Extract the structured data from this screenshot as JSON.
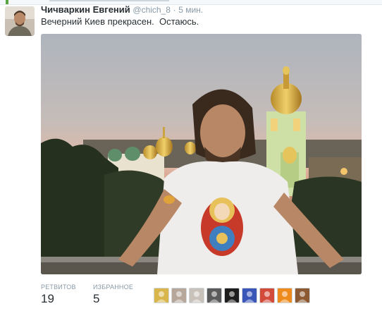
{
  "tweet": {
    "author_name": "Чичваркин Евгений",
    "author_handle": "@chich_8",
    "separator": "·",
    "time": "5 мин.",
    "text": "Вечерний Киев прекрасен.  Остаюсь."
  },
  "stats": {
    "retweets_label": "РЕТВИТОВ",
    "retweets_count": "19",
    "favorites_label": "ИЗБРАННОЕ",
    "favorites_count": "5"
  },
  "favoriters": [
    {
      "icon": "avatar-cartoon-icon",
      "color": "#d9b64b"
    },
    {
      "icon": "avatar-woman-icon",
      "color": "#b7a79a"
    },
    {
      "icon": "avatar-person-icon",
      "color": "#c9c2bb"
    },
    {
      "icon": "avatar-bw-icon",
      "color": "#5a5a5a"
    },
    {
      "icon": "avatar-logo-icon",
      "color": "#1e1e1e"
    },
    {
      "icon": "avatar-flag-icon",
      "color": "#3a56b8"
    },
    {
      "icon": "avatar-tricolor-icon",
      "color": "#d24b3a"
    },
    {
      "icon": "avatar-orange-icon",
      "color": "#ef8a1d"
    },
    {
      "icon": "avatar-brown-icon",
      "color": "#8b5a32"
    }
  ],
  "colors": {
    "accent_green": "#59a545",
    "muted_text": "#8899a6",
    "body_text": "#292f33"
  }
}
